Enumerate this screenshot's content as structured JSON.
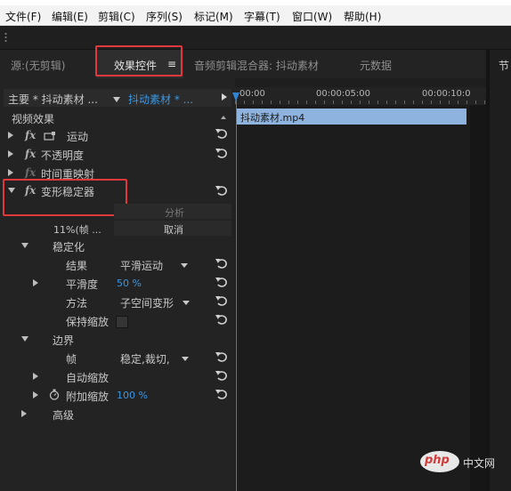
{
  "menu": [
    "文件(F)",
    "编辑(E)",
    "剪辑(C)",
    "序列(S)",
    "标记(M)",
    "字幕(T)",
    "窗口(W)",
    "帮助(H)"
  ],
  "tabs": {
    "source": "源:(无剪辑)",
    "effect_controls": "效果控件",
    "effect_controls_menu": "≡",
    "audio_mixer": "音频剪辑混合器: 抖动素材",
    "metadata": "元数据",
    "right_partial": "节"
  },
  "header": {
    "master": "主要 * 抖动素材 ...",
    "sequence": "抖动素材 * ..."
  },
  "ruler": [
    "00:00",
    "00:00:05:00",
    "00:00:10:0"
  ],
  "clip": {
    "name": "抖动素材.mp4"
  },
  "section_label": "视频效果",
  "effects": {
    "motion": "运动",
    "opacity": "不透明度",
    "time_remap": "时间重映射",
    "warp": "变形稳定器",
    "fx": "fx"
  },
  "analyze": {
    "analyze_button": "分析",
    "progress": "11%(帧 ...",
    "cancel_button": "取消"
  },
  "stabilize": {
    "label": "稳定化",
    "result_label": "结果",
    "result_value": "平滑运动",
    "smoothness_label": "平滑度",
    "smoothness_value": "50 %",
    "method_label": "方法",
    "method_value": "子空间变形",
    "keep_scale_label": "保持缩放"
  },
  "borders": {
    "label": "边界",
    "frame_label": "帧",
    "frame_value": "稳定,裁切,",
    "auto_scale_label": "自动缩放",
    "additional_scale_label": "附加缩放",
    "additional_scale_value": "100 %"
  },
  "advanced": "高级",
  "watermark": {
    "text": "php",
    "suffix": "中文网"
  },
  "colors": {
    "accent_blue": "#3a97e3",
    "highlight_red": "#e0383d",
    "clip_blue": "#8eb3de",
    "panel": "#232323"
  }
}
